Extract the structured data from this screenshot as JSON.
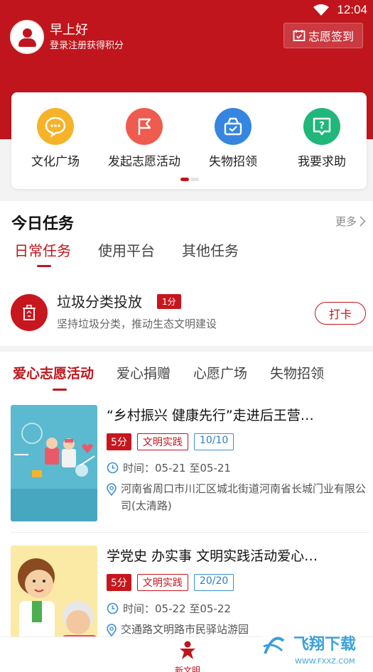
{
  "status_bar": {
    "time": "12:04"
  },
  "header": {
    "greeting": "早上好",
    "subtitle": "登录注册获得积分",
    "checkin_label": "志愿签到"
  },
  "quick_menu": [
    {
      "label": "文化广场",
      "color": "#f6b32a",
      "icon": "chat-bubble-icon"
    },
    {
      "label": "发起志愿活动",
      "color": "#ee5b4f",
      "icon": "flag-icon"
    },
    {
      "label": "失物招领",
      "color": "#3486e0",
      "icon": "box-icon"
    },
    {
      "label": "我要求助",
      "color": "#21b67a",
      "icon": "help-icon"
    }
  ],
  "tasks": {
    "title": "今日任务",
    "more": "更多",
    "tabs": [
      "日常任务",
      "使用平台",
      "其他任务"
    ],
    "item": {
      "name": "垃圾分类投放",
      "points": "1分",
      "desc": "坚持垃圾分类，推动生态文明建设",
      "action": "打卡"
    }
  },
  "activities": {
    "tabs": [
      "爱心志愿活动",
      "爱心捐赠",
      "心愿广场",
      "失物招领"
    ],
    "items": [
      {
        "title": "“乡村振兴 健康先行”走进后王营…",
        "points": "5分",
        "category": "文明实践",
        "quota": "10/10",
        "time": "时间：05-21 至05-21",
        "address": "河南省周口市川汇区城北街道河南省长城门业有限公司(太清路)"
      },
      {
        "title": "学党史 办实事 文明实践活动爱心…",
        "points": "5分",
        "category": "文明实践",
        "quota": "20/20",
        "time": "时间：05-22 至05-22",
        "address": "交通路文明路市民驿站游园"
      }
    ]
  },
  "bottom_nav": {
    "home_label": "新文明"
  },
  "watermark": {
    "text": "飞翔下载",
    "url": "WWW.FXXZ.COM"
  },
  "colors": {
    "brand_red": "#c0151c"
  }
}
